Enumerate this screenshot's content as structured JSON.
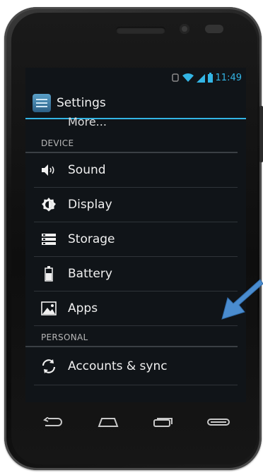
{
  "status_bar": {
    "time": "11:49",
    "icons": [
      "alarm-icon",
      "wifi-icon",
      "signal-icon",
      "battery-icon"
    ]
  },
  "action_bar": {
    "title": "Settings",
    "icon": "settings-app-icon"
  },
  "partial_item": {
    "label": "More..."
  },
  "sections": {
    "device": {
      "label": "DEVICE"
    },
    "personal": {
      "label": "PERSONAL"
    }
  },
  "device_items": [
    {
      "label": "Sound",
      "icon": "sound-icon"
    },
    {
      "label": "Display",
      "icon": "display-icon"
    },
    {
      "label": "Storage",
      "icon": "storage-icon"
    },
    {
      "label": "Battery",
      "icon": "battery-icon"
    },
    {
      "label": "Apps",
      "icon": "apps-icon"
    }
  ],
  "personal_items": [
    {
      "label": "Accounts & sync",
      "icon": "sync-icon"
    }
  ],
  "nav_buttons": [
    "back-icon",
    "home-icon",
    "recent-apps-icon",
    "menu-icon"
  ],
  "colors": {
    "accent": "#33b5e5",
    "arrow": "#4a8ccf",
    "screen_bg": "#101418"
  }
}
